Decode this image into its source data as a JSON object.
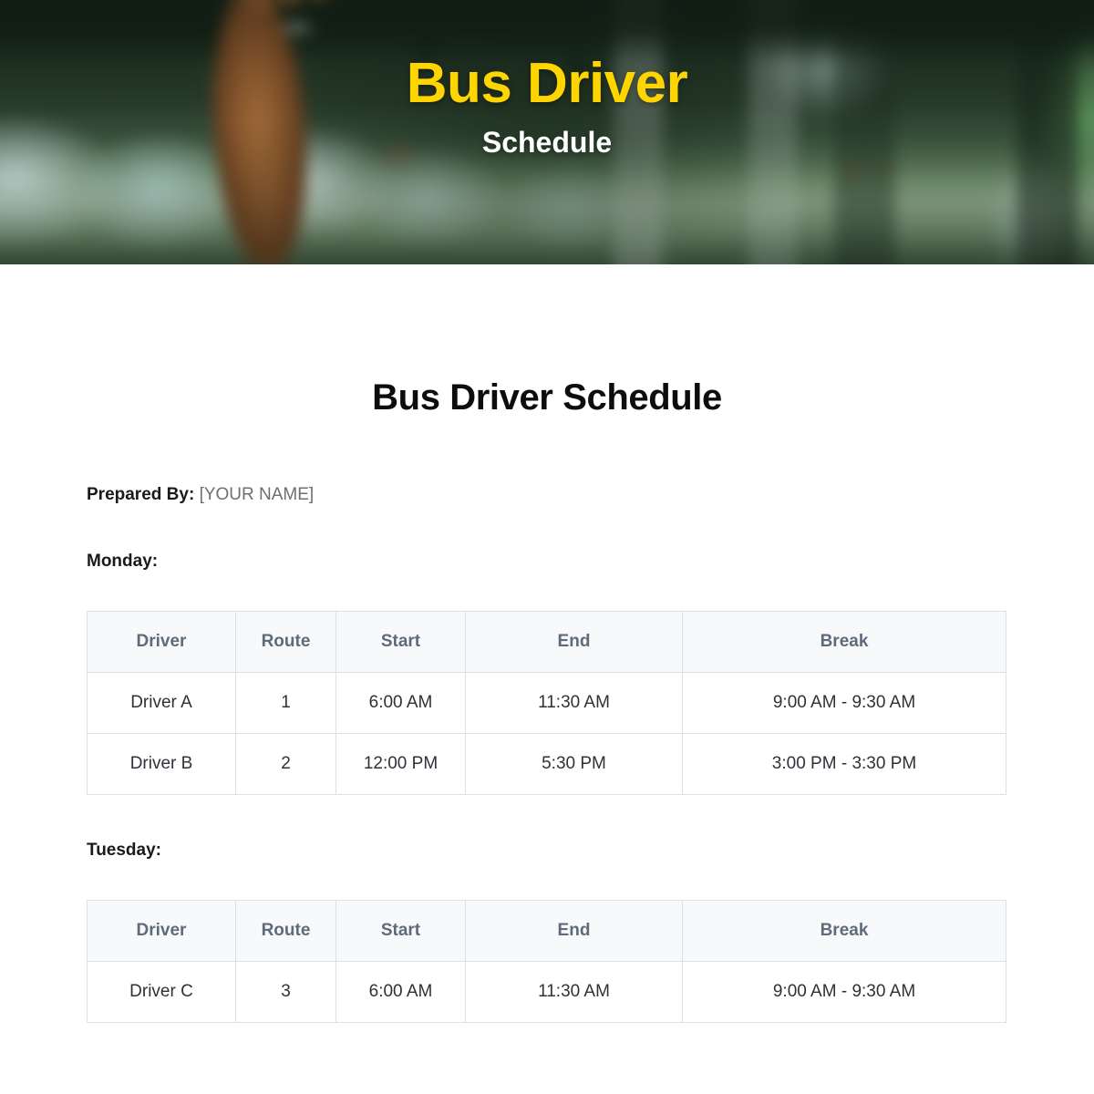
{
  "hero": {
    "title": "Bus Driver",
    "subtitle": "Schedule",
    "title_color": "#FFD500",
    "subtitle_color": "#FFFFFF",
    "image_description": "blurred bus interior with a hand gripping an overhead rail"
  },
  "document": {
    "title": "Bus Driver Schedule",
    "prepared_by_label": "Prepared By:",
    "prepared_by_value": "[YOUR NAME]"
  },
  "colors": {
    "header_bg": "#F7F9FB",
    "header_text": "#5F6B7A",
    "body_text": "#2E3238",
    "border": "#DCDFE3",
    "accent_yellow": "#FFD500"
  },
  "columns": [
    "Driver",
    "Route",
    "Start",
    "End",
    "Break"
  ],
  "days": [
    {
      "label": "Monday:",
      "rows": [
        {
          "driver": "Driver A",
          "route": "1",
          "start": "6:00 AM",
          "end": "11:30 AM",
          "break": "9:00 AM - 9:30 AM"
        },
        {
          "driver": "Driver B",
          "route": "2",
          "start": "12:00 PM",
          "end": "5:30 PM",
          "break": "3:00 PM - 3:30 PM"
        }
      ]
    },
    {
      "label": "Tuesday:",
      "rows": [
        {
          "driver": "Driver C",
          "route": "3",
          "start": "6:00 AM",
          "end": "11:30 AM",
          "break": "9:00 AM - 9:30 AM"
        }
      ]
    }
  ]
}
